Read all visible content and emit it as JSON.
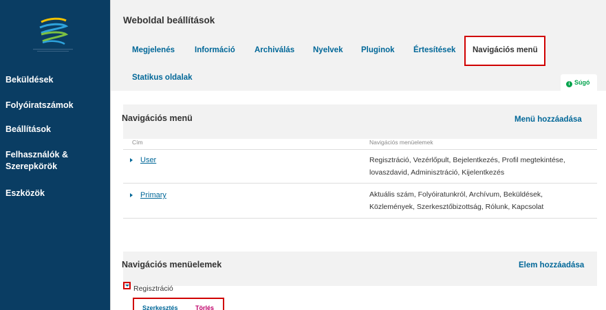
{
  "sidebar": {
    "items": [
      {
        "label": "Beküldések"
      },
      {
        "label": "Folyóiratszámok"
      },
      {
        "label": "Beállítások"
      },
      {
        "label": "Felhasználók &"
      },
      {
        "label": "Szerepkörök"
      },
      {
        "label": "Eszközök"
      }
    ]
  },
  "header": {
    "title": "Weboldal beállítások",
    "tabs": [
      {
        "label": "Megjelenés"
      },
      {
        "label": "Információ"
      },
      {
        "label": "Archiválás"
      },
      {
        "label": "Nyelvek"
      },
      {
        "label": "Pluginok"
      },
      {
        "label": "Értesítések"
      },
      {
        "label": "Navigációs menü"
      },
      {
        "label": "Statikus oldalak"
      }
    ],
    "help_label": "Súgó",
    "help_icon": "i"
  },
  "menus_panel": {
    "title": "Navigációs menü",
    "add_label": "Menü hozzáadása",
    "columns": [
      "Cím",
      "Navigációs menüelemek"
    ],
    "rows": [
      {
        "name": "User",
        "line1": "Regisztráció, Vezérlőpult, Bejelentkezés, Profil megtekintése,",
        "line2": "lovaszdavid, Adminisztráció, Kijelentkezés"
      },
      {
        "name": "Primary",
        "line1": "Aktuális szám, Folyóiratunkról, Archívum, Beküldések,",
        "line2": "Közlemények, Szerkesztőbizottság, Rólunk, Kapcsolat"
      }
    ]
  },
  "items_panel": {
    "title": "Navigációs menüelemek",
    "add_label": "Elem hozzáadása",
    "expanded_item": "Regisztráció",
    "edit_label": "Szerkesztés",
    "delete_label": "Törlés"
  },
  "colors": {
    "sidebar": "#0a3d63",
    "link": "#006798",
    "highlight": "#d00000",
    "help": "#00a34c",
    "delete": "#c0006a"
  }
}
